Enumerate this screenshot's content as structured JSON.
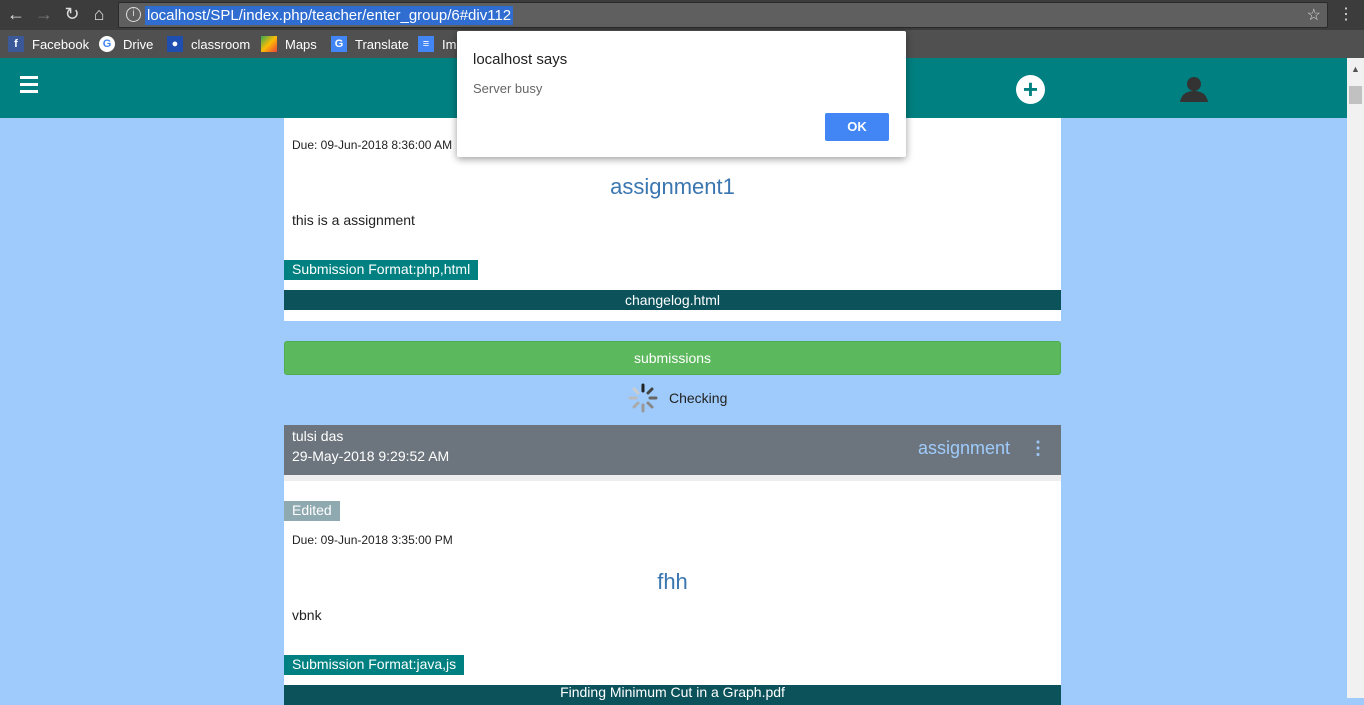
{
  "browser": {
    "url": "localhost/SPL/index.php/teacher/enter_group/6#div112",
    "bookmarks": [
      {
        "label": "Facebook",
        "icon": "facebook-icon",
        "color": "#3b5998"
      },
      {
        "label": "Drive",
        "icon": "google-icon",
        "color": "#ffffff"
      },
      {
        "label": "classroom",
        "icon": "classroom-icon",
        "color": "#1e4fb0"
      },
      {
        "label": "Maps",
        "icon": "maps-icon",
        "color": "#34a853"
      },
      {
        "label": "Translate",
        "icon": "translate-icon",
        "color": "#4285f4"
      },
      {
        "label": "Im",
        "icon": "docs-icon",
        "color": "#4285f4"
      }
    ]
  },
  "colors": {
    "header": "#008080",
    "page_bg": "#9fcbfc",
    "submissions": "#5cb85c",
    "file_bar": "#0b525b",
    "post_header": "#6c757d"
  },
  "dialog": {
    "title": "localhost says",
    "message": "Server busy",
    "ok": "OK"
  },
  "post1": {
    "due": "Due: 09-Jun-2018 8:36:00 AM",
    "title": "assignment1",
    "description": "this is a assignment",
    "format": "Submission Format:php,html",
    "file": "changelog.html",
    "submissions": "submissions",
    "checking": "Checking"
  },
  "post2": {
    "author": "tulsi das",
    "date": "29-May-2018 9:29:52 AM",
    "type": "assignment",
    "edited": "Edited",
    "due": "Due: 09-Jun-2018 3:35:00 PM",
    "title": "fhh",
    "description": "vbnk",
    "format": "Submission Format:java,js",
    "file": "Finding Minimum Cut in a Graph.pdf"
  }
}
